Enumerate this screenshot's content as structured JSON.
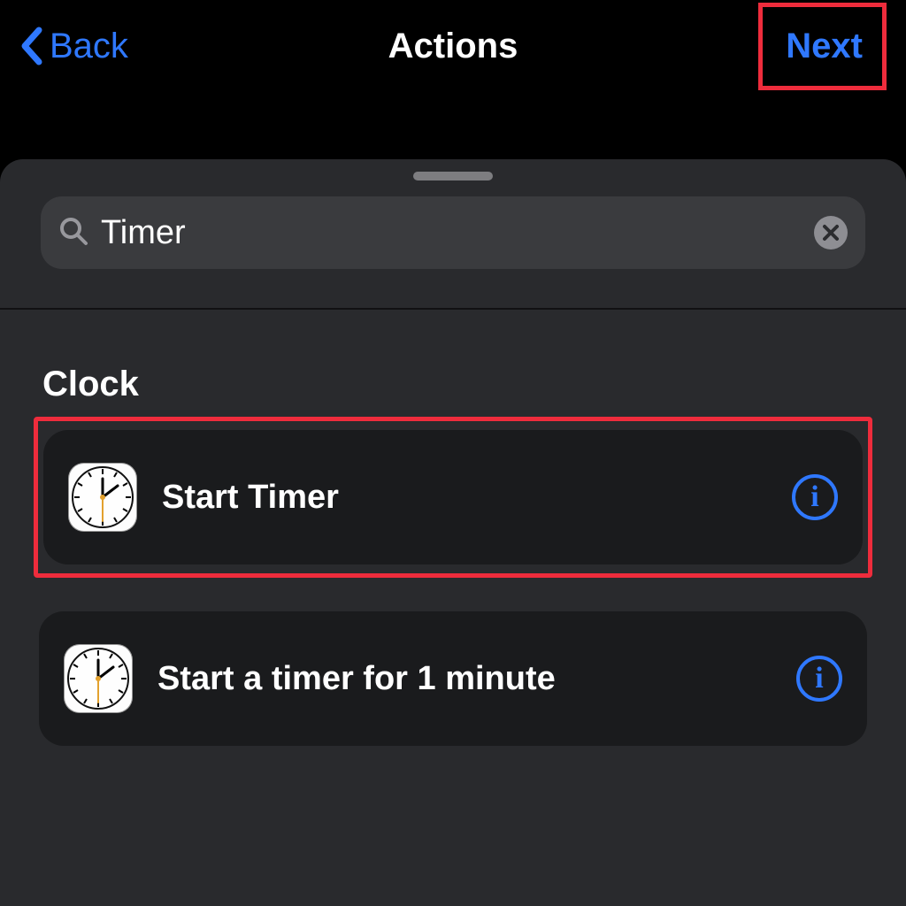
{
  "nav": {
    "back_label": "Back",
    "title": "Actions",
    "next_label": "Next"
  },
  "search": {
    "value": "Timer",
    "placeholder": "Search"
  },
  "section": {
    "title": "Clock",
    "actions": [
      {
        "label": "Start Timer",
        "highlighted": true
      },
      {
        "label": "Start a timer for 1 minute",
        "highlighted": false
      }
    ]
  },
  "icons": {
    "back": "chevron-left-icon",
    "search": "search-icon",
    "clear": "clear-icon",
    "clock": "clock-app-icon",
    "info": "info-icon"
  },
  "colors": {
    "accent": "#2f78ff",
    "highlight": "#ee2c3c",
    "sheet_bg": "#292a2d",
    "row_bg": "#1a1b1d"
  }
}
